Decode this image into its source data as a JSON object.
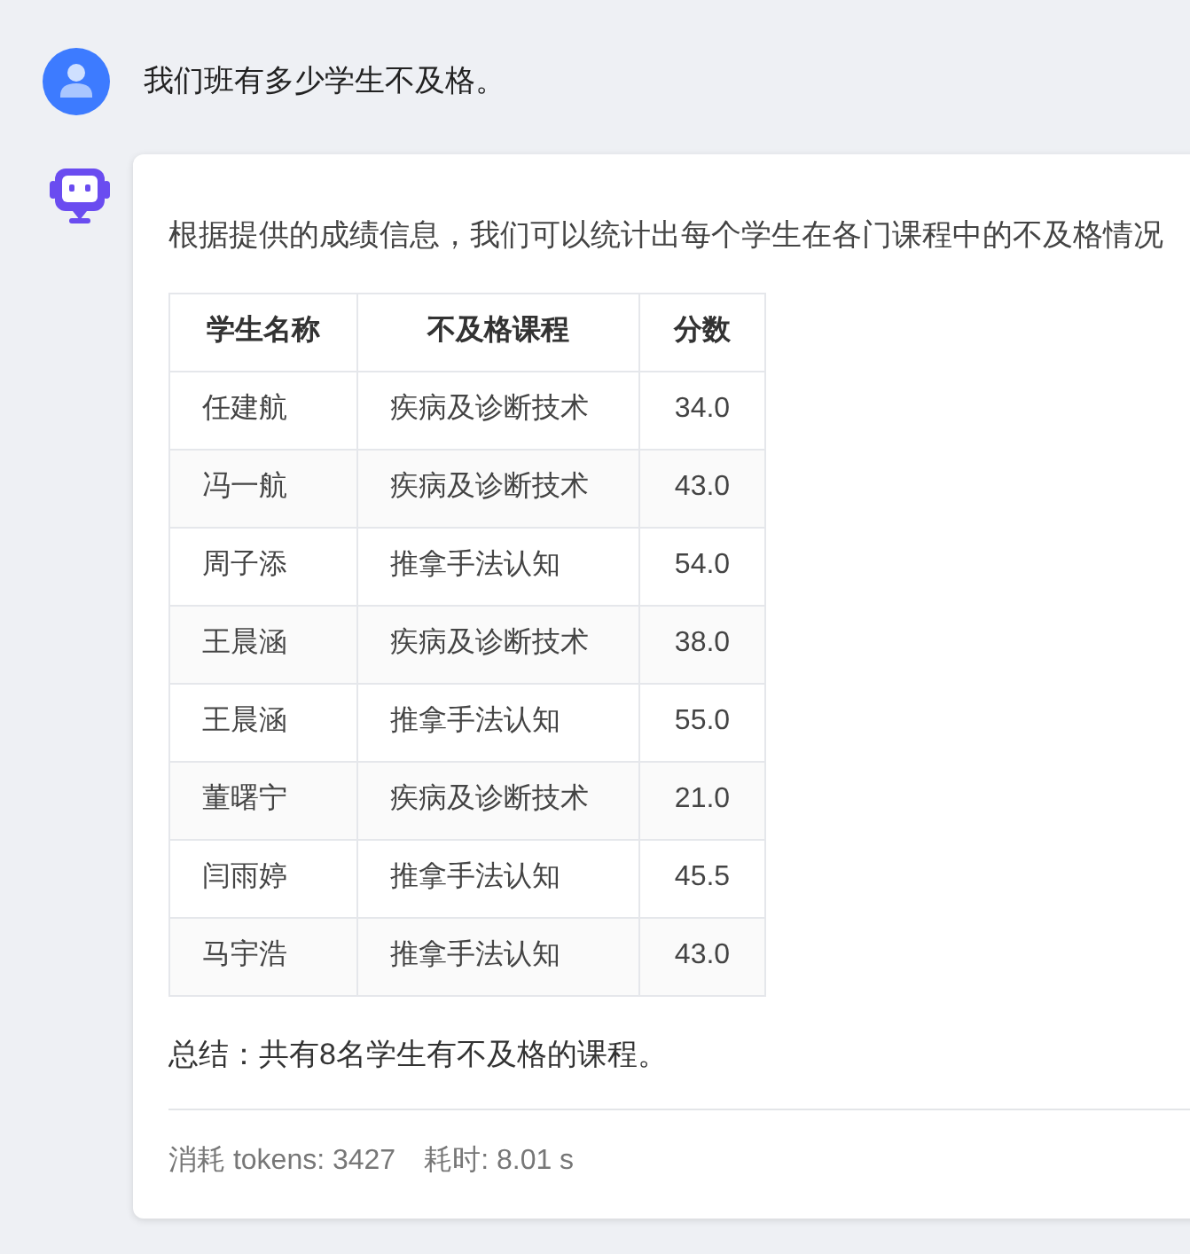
{
  "messages": [
    {
      "kind": "user",
      "text": "我们班有多少学生不及格。"
    },
    {
      "kind": "bot",
      "intro": "根据提供的成绩信息，我们可以统计出每个学生在各门课程中的不及格情况",
      "table": {
        "columns": [
          "学生名称",
          "不及格课程",
          "分数"
        ],
        "rows": [
          [
            "任建航",
            "疾病及诊断技术",
            "34.0"
          ],
          [
            "冯一航",
            "疾病及诊断技术",
            "43.0"
          ],
          [
            "周子添",
            "推拿手法认知",
            "54.0"
          ],
          [
            "王晨涵",
            "疾病及诊断技术",
            "38.0"
          ],
          [
            "王晨涵",
            "推拿手法认知",
            "55.0"
          ],
          [
            "董曙宁",
            "疾病及诊断技术",
            "21.0"
          ],
          [
            "闫雨婷",
            "推拿手法认知",
            "45.5"
          ],
          [
            "马宇浩",
            "推拿手法认知",
            "43.0"
          ]
        ]
      },
      "summary": "总结：共有8名学生有不及格的课程。",
      "footer": [
        "消耗 tokens: 3427",
        "耗时: 8.01 s"
      ]
    }
  ]
}
